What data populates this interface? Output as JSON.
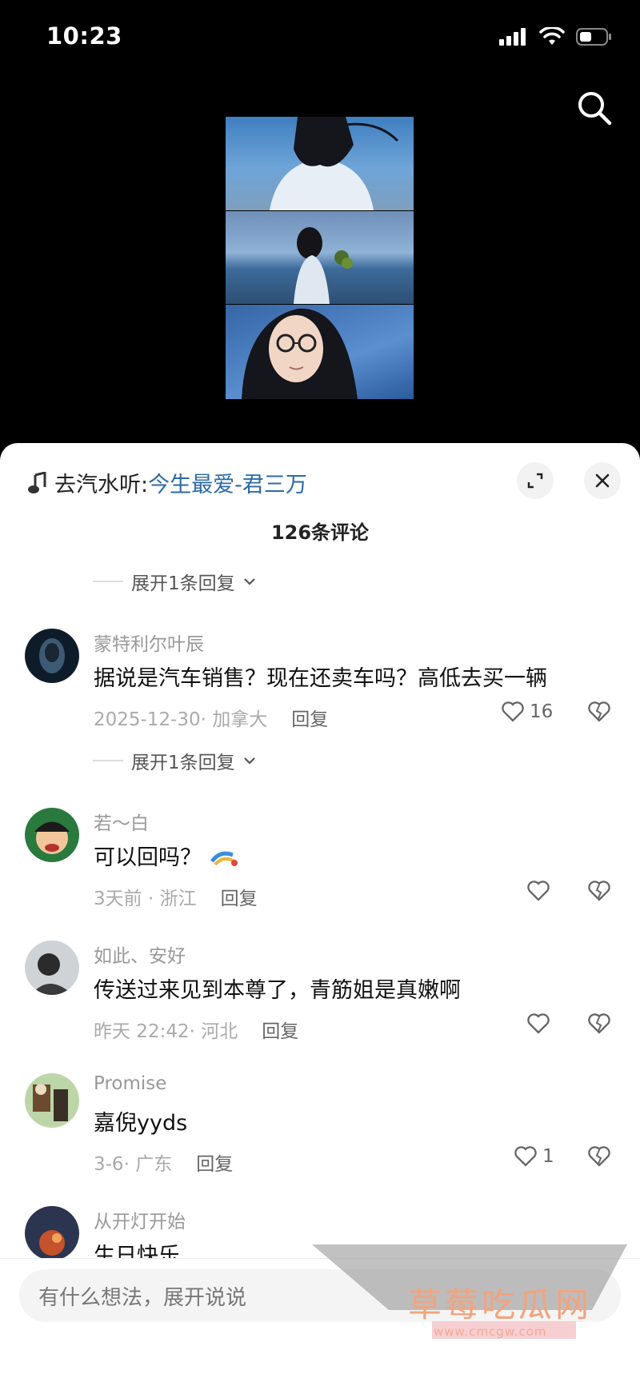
{
  "status": {
    "time": "10:23"
  },
  "music": {
    "prefix": "去汽水听:",
    "song": "今生最爱-君三万"
  },
  "comments_header": {
    "title": "126条评论"
  },
  "expand_reply_label": "展开1条回复",
  "comments": [
    {
      "user": "蒙特利尔叶辰",
      "text": "据说是汽车销售？现在还卖车吗？高低去买一辆",
      "meta": "2025-12-30· 加拿大",
      "reply": "回复",
      "likes": "16"
    },
    {
      "user": "若～白",
      "text": "可以回吗？",
      "meta": "3天前 · 浙江",
      "reply": "回复",
      "likes": ""
    },
    {
      "user": "如此、安好",
      "text": "传送过来见到本尊了，青筋姐是真嫩啊",
      "meta": "昨天 22:42· 河北",
      "reply": "回复",
      "likes": ""
    },
    {
      "user": "Promise",
      "text": "嘉倪yyds",
      "meta": "3-6· 广东",
      "reply": "回复",
      "likes": "1"
    },
    {
      "user": "从开灯开始",
      "text": "生日快乐",
      "meta": "",
      "reply": "",
      "likes": ""
    }
  ],
  "input": {
    "placeholder": "有什么想法，展开说说"
  },
  "watermark": {
    "title": "草莓吃瓜网",
    "url": "www.cmcgw.com"
  },
  "colors": {
    "accent_link": "#2b6aa8",
    "sheet_bg": "#ffffff",
    "page_bg": "#000000"
  }
}
